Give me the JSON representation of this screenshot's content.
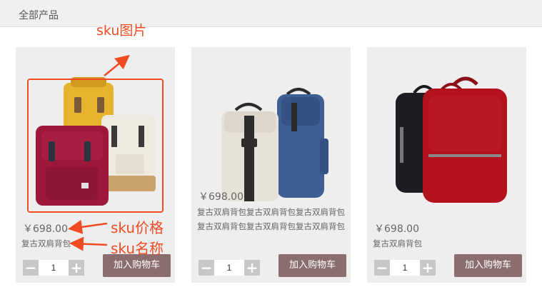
{
  "header": {
    "title": "全部产品"
  },
  "products": [
    {
      "image_icon": "yellow-red-backpacks-image",
      "price": "￥698.00",
      "name": "复古双肩背包",
      "quantity": "1",
      "cart_label": "加入购物车"
    },
    {
      "image_icon": "white-blue-backpacks-image",
      "price": "￥698.00",
      "name": "复古双肩背包复古双肩背包复古双肩背包复古双肩背包复古双肩背包复古双肩背包",
      "quantity": "1",
      "cart_label": "加入购物车"
    },
    {
      "image_icon": "black-red-backpacks-image",
      "price": "￥698.00",
      "name": "复古双肩背包",
      "quantity": "1",
      "cart_label": "加入购物车"
    }
  ],
  "stepper": {
    "minus": "−",
    "plus": "+"
  },
  "annotations": {
    "image": "sku图片",
    "price": "sku价格",
    "name": "sku名称"
  },
  "colors": {
    "annotation": "#f04b23",
    "cart_button": "#8b6d70",
    "stepper": "#c7c7c7",
    "card_bg": "#eeeeee"
  }
}
